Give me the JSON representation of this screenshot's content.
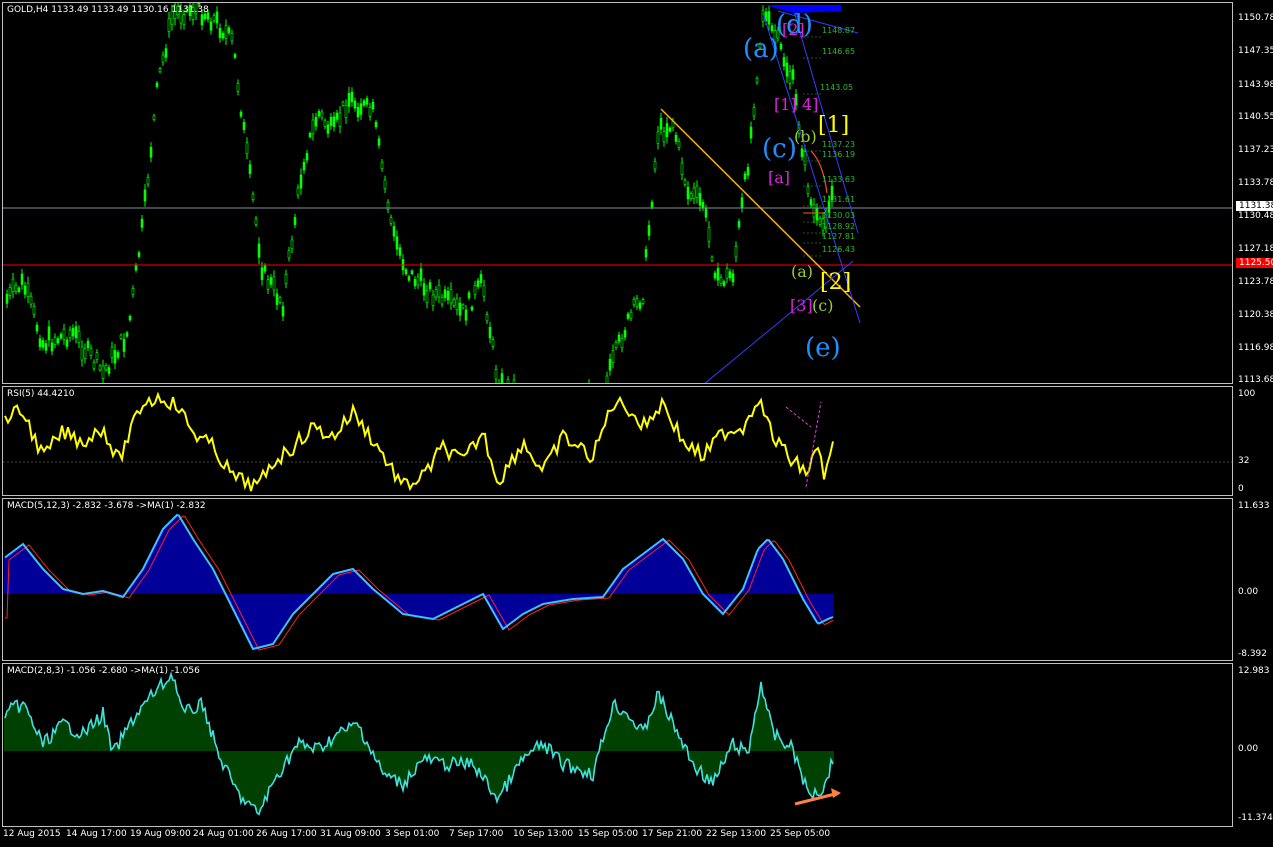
{
  "main": {
    "title": "GOLD,H4  1133.49 1133.49 1130.16 1131.38",
    "axis": [
      "1150.78",
      "1147.35",
      "1143.98",
      "1140.55",
      "1137.23",
      "1133.78",
      "1130.48",
      "1127.18",
      "1123.78",
      "1120.38",
      "1116.98",
      "1113.68"
    ],
    "price_tag": "1131.38",
    "level_tag": "1125.50",
    "fib_levels": [
      "1148.87",
      "1146.65",
      "1143.05",
      "1137.23",
      "1136.19",
      "1133.63",
      "1131.61",
      "1130.03",
      "1128.92",
      "1127.81",
      "1126.43"
    ],
    "wave_labels": {
      "d": "(d)",
      "a_blue": "(a)",
      "c_blue": "(c)",
      "e_blue": "(e)",
      "two_pink": "[2]",
      "one_pink": "[1]",
      "four_pink": "4]",
      "a_pink": "[a]",
      "three_pink": "[3]",
      "b_olive": "(b)",
      "a_olive": "(a)",
      "c_olive": "(c)",
      "one_yellow": "[1]",
      "two_yellow": "[2]"
    },
    "colors": {
      "candles": "#00ff00",
      "trend": "#ffb000",
      "price_line": "#8090a0",
      "level_line": "#ff0000",
      "fib": "#2db52d"
    }
  },
  "rsi": {
    "title": "RSI(5) 44.4210",
    "axis": [
      "100",
      "32",
      "0"
    ],
    "color": "#ffff00"
  },
  "macd1": {
    "title": "MACD(5,12,3) -2.832 -3.678  ->MA(1) -2.832",
    "axis": [
      "11.633",
      "0.00",
      "-8.392"
    ],
    "hist_color": "#0000ff",
    "line_color": "#40c0ff"
  },
  "macd2": {
    "title": "MACD(2,8,3) -1.056 -2.680  ->MA(1) -1.056",
    "axis": [
      "12.983",
      "0.00",
      "-11.374"
    ],
    "hist_color": "#008000",
    "line_color": "#40e0e0"
  },
  "x_axis": [
    "12 Aug 2015",
    "14 Aug 17:00",
    "19 Aug 09:00",
    "24 Aug 01:00",
    "26 Aug 17:00",
    "31 Aug 09:00",
    "3 Sep 01:00",
    "7 Sep 17:00",
    "10 Sep 13:00",
    "15 Sep 05:00",
    "17 Sep 21:00",
    "22 Sep 13:00",
    "25 Sep 05:00"
  ]
}
